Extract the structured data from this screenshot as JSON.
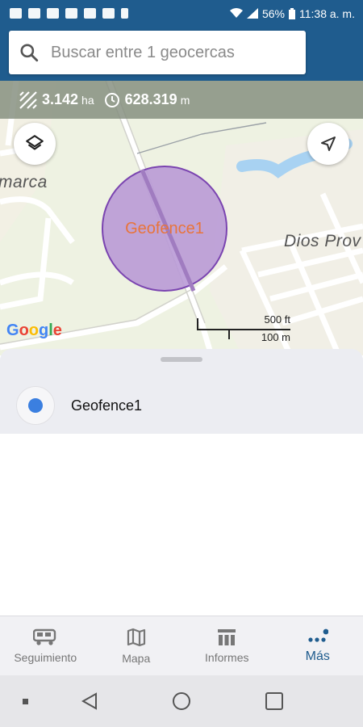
{
  "status_bar": {
    "battery": "56%",
    "time": "11:38 a. m."
  },
  "search": {
    "placeholder": "Buscar entre 1 geocercas"
  },
  "metrics": {
    "area_value": "3.142",
    "area_unit": "ha",
    "perimeter_value": "628.319",
    "perimeter_unit": "m"
  },
  "map": {
    "fence_label": "Geofence1",
    "place_labels": [
      "marca",
      "Dios Prov"
    ],
    "logo": "Google",
    "scale": {
      "feet": "500 ft",
      "meters": "100 m"
    },
    "colors": {
      "fence_fill": "#b99ad6",
      "fence_stroke": "#7a44b0",
      "water": "#a8d2f2"
    }
  },
  "geofences": [
    {
      "name": "Geofence1",
      "color": "#3b7fe0"
    }
  ],
  "nav": {
    "items": [
      {
        "label": "Seguimiento",
        "icon": "truck-icon"
      },
      {
        "label": "Mapa",
        "icon": "map-icon"
      },
      {
        "label": "Informes",
        "icon": "reports-icon"
      },
      {
        "label": "Más",
        "icon": "more-icon"
      }
    ],
    "active": "Más"
  },
  "colors": {
    "primary": "#1f5c8e",
    "accent": "#3b7fe0"
  }
}
